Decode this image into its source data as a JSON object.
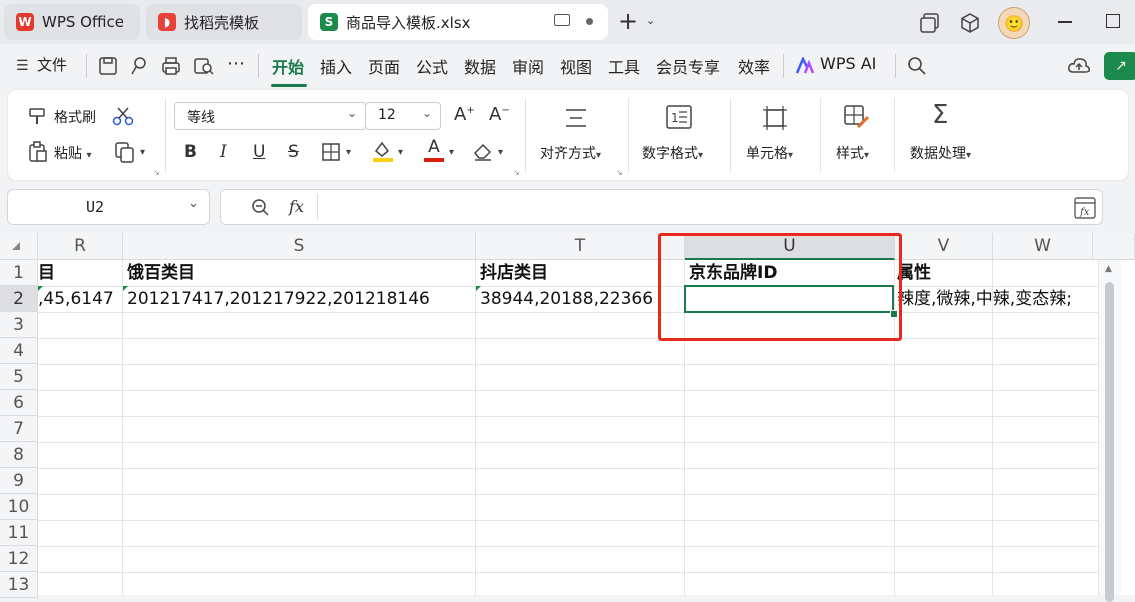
{
  "titlebar": {
    "tabs": [
      {
        "label": "WPS Office",
        "icon": "wps-logo-icon"
      },
      {
        "label": "找稻壳模板",
        "icon": "docer-icon"
      },
      {
        "label": "商品导入模板.xlsx",
        "icon": "spreadsheet-icon",
        "icon_letter": "S"
      }
    ],
    "new_tab_symbol": "+",
    "avatar_emoji": "🙂"
  },
  "menubar": {
    "file_label": "文件",
    "items": [
      "开始",
      "插入",
      "页面",
      "公式",
      "数据",
      "审阅",
      "视图",
      "工具",
      "会员专享",
      "效率"
    ],
    "active": "开始",
    "wps_ai_label": "WPS AI"
  },
  "ribbon": {
    "format_painter": "格式刷",
    "paste": "粘贴",
    "font_name": "等线",
    "font_size": "12",
    "align": "对齐方式",
    "number_format": "数字格式",
    "cell": "单元格",
    "style": "样式",
    "data_process": "数据处理",
    "bold": "B",
    "italic": "I",
    "underline": "U",
    "strikethrough": "S",
    "fill_color": "#f5d20a",
    "font_color": "#d81e06"
  },
  "formulabar": {
    "name_box": "U2",
    "fx": "fx",
    "formula": ""
  },
  "grid": {
    "columns": [
      "R",
      "S",
      "T",
      "U",
      "V",
      "W"
    ],
    "selected_column": "U",
    "rows": [
      "1",
      "2",
      "3",
      "4",
      "5",
      "6",
      "7",
      "8",
      "9",
      "10",
      "11",
      "12",
      "13"
    ],
    "row1": {
      "R": "目",
      "S": "饿百类目",
      "T": "抖店类目",
      "U": "京东品牌ID",
      "V": "属性"
    },
    "row2": {
      "R": ",45,6147",
      "S": "201217417,201217922,201218146",
      "T": "38944,20188,22366",
      "U": "",
      "V": "辣度,微辣,中辣,变态辣;"
    },
    "accent_color": "#1b7a4b",
    "highlight_color": "#e8291c"
  }
}
